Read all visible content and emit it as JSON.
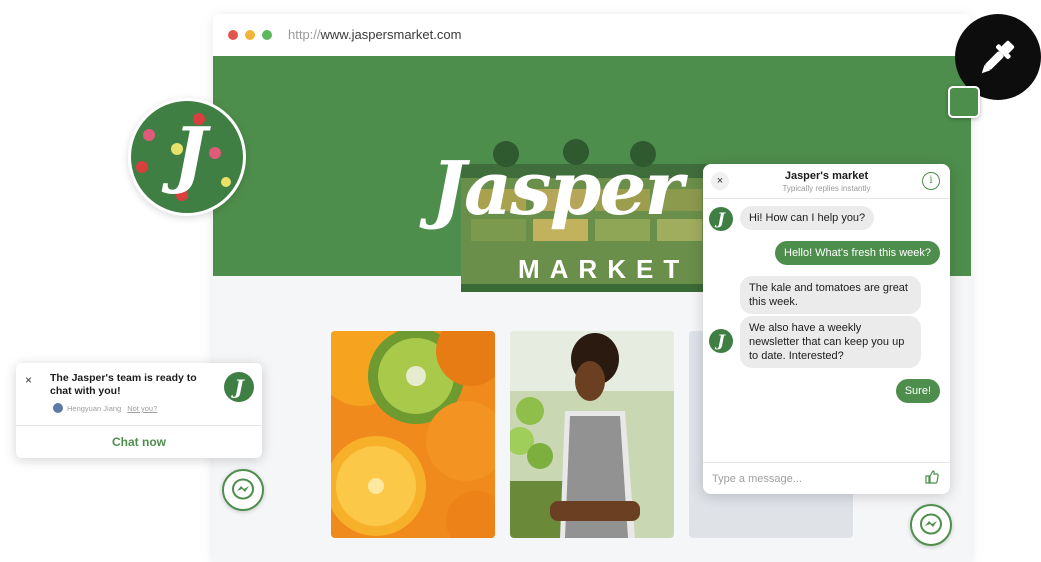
{
  "browser": {
    "url_protocol": "http://",
    "url_host": "www.jaspersmarket.com"
  },
  "hero": {
    "logo_word": "Jasper",
    "logo_sub": "MARKET"
  },
  "badge": {
    "letter": "J"
  },
  "chat": {
    "title": "Jasper's market",
    "subtitle": "Typically replies instantly",
    "close_glyph": "×",
    "info_glyph": "i",
    "messages": [
      {
        "from": "bot",
        "text": "Hi! How can I help you?"
      },
      {
        "from": "user",
        "text": "Hello! What's fresh this week?"
      },
      {
        "from": "bot",
        "text": "The kale and tomatoes are great this week."
      },
      {
        "from": "bot",
        "text": "We also have a weekly newsletter that can keep you up to date. Interested?"
      },
      {
        "from": "user",
        "text": "Sure!"
      }
    ],
    "input_placeholder": "Type a message...",
    "like_glyph": "👍"
  },
  "notification": {
    "close_glyph": "×",
    "message": "The Jasper's team is ready to chat with you!",
    "user_name": "Hengyuan Jiang",
    "not_you": "Not you?",
    "cta": "Chat now"
  },
  "colors": {
    "brand_green": "#4e8e4c",
    "dark_green": "#3f7f44",
    "bubble_in": "#ebebeb"
  },
  "icons": [
    "eyedropper-icon",
    "messenger-icon",
    "thumbs-up-icon",
    "info-icon",
    "close-icon"
  ]
}
